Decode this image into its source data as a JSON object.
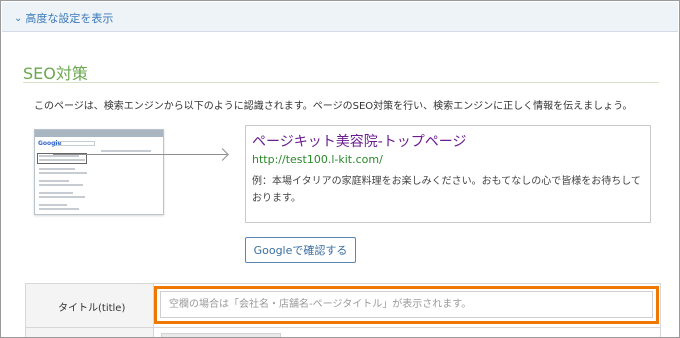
{
  "advanced_toggle": {
    "label": "高度な設定を表示",
    "icon": "chevron-down-icon"
  },
  "seo_section": {
    "title": "SEO対策",
    "description": "このページは、検索エンジンから以下のように認識されます。ページのSEO対策を行い、検索エンジンに正しく情報を伝えましょう。",
    "thumbnail_logo": "Google",
    "preview": {
      "title": "ページキット美容院-トップページ",
      "url": "http://test100.l-kit.com/",
      "description": "例：本場イタリアの家庭料理をお楽しみください。おもてなしの心で皆様をお待ちしております。"
    },
    "google_check_button": "Googleで確認する"
  },
  "title_field": {
    "label": "タイトル(title)",
    "value": "",
    "placeholder": "空欄の場合は「会社名・店舗名-ページタイトル」が表示されます。"
  },
  "colors": {
    "accent_green": "#6aa84f",
    "link_blue": "#3b79b8",
    "highlight_orange": "#ee7800",
    "preview_title": "#6b1d8f",
    "preview_url": "#2b8a2b"
  }
}
